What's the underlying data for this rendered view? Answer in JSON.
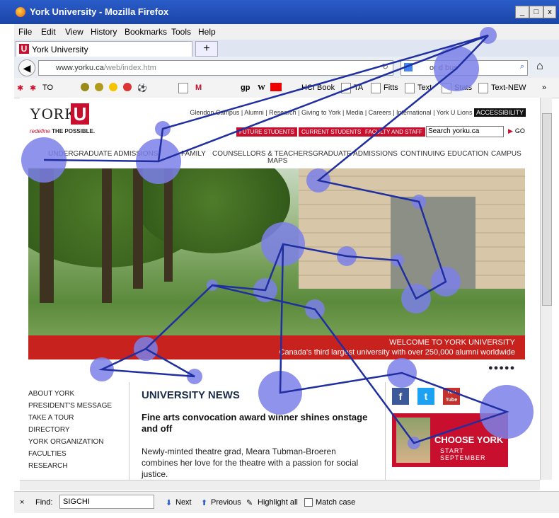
{
  "window": {
    "title": "York University - Mozilla Firefox",
    "controls": [
      "_",
      "□",
      "x"
    ]
  },
  "menu": [
    "File",
    "Edit",
    "View",
    "History",
    "Bookmarks",
    "Tools",
    "Help"
  ],
  "tab": {
    "label": "York University",
    "new_tab": "+"
  },
  "nav": {
    "url_domain": "www.yorku.ca",
    "url_path": "/web/index.htm",
    "search_value": "or d bus"
  },
  "bookmarks": [
    "TO",
    "gp",
    "W",
    "HCI Book",
    "TA",
    "Fitts",
    "Text",
    "Stats",
    "Text-NEW",
    "»"
  ],
  "site": {
    "logo": "YORK",
    "logo_u": "U",
    "tagline_a": "redefine",
    "tagline_b": "THE POSSIBLE.",
    "top_links": "Glendon Campus | Alumni | Research | Giving to York | Media | Careers | International | York U Lions",
    "accessibility": "ACCESSIBILITY",
    "buttons": [
      "FUTURE STUDENTS",
      "CURRENT STUDENTS",
      "FACULTY AND STAFF"
    ],
    "search_value": "Search yorku.ca",
    "go": "GO",
    "nav": [
      "UNDERGRADUATE ADMISSIONS",
      "FAMILY",
      "COUNSELLORS & TEACHERS",
      "MAPS",
      "GRADUATE ADMISSIONS",
      "CONTINUING EDUCATION",
      "CAMPUS"
    ],
    "banner_title": "WELCOME TO YORK UNIVERSITY",
    "banner_sub": "Canada's third largest university with over 250,000 alumni worldwide",
    "dots": "●●●●●",
    "left_nav": [
      "ABOUT YORK",
      "PRESIDENT'S MESSAGE",
      "TAKE A TOUR",
      "DIRECTORY",
      "YORK ORGANIZATION",
      "FACULTIES",
      "RESEARCH"
    ],
    "news_heading": "UNIVERSITY NEWS",
    "headline": "Fine arts convocation award winner shines onstage and off",
    "body": "Newly-minted theatre grad, Meara Tubman-Broeren combines her love for the theatre with a passion for social justice.",
    "social": [
      "f",
      "t",
      "You Tube"
    ],
    "choose": "CHOOSE YORK",
    "start": "START SEPTEMBER"
  },
  "find": {
    "close": "×",
    "label": "Find:",
    "value": "SIGCHI",
    "next": "Next",
    "previous": "Previous",
    "highlight": "Highlight all",
    "match_case": "Match case"
  },
  "colors": {
    "gaze": "#7b80e8",
    "path": "#1f2ea0",
    "york_red": "#c8102e"
  }
}
